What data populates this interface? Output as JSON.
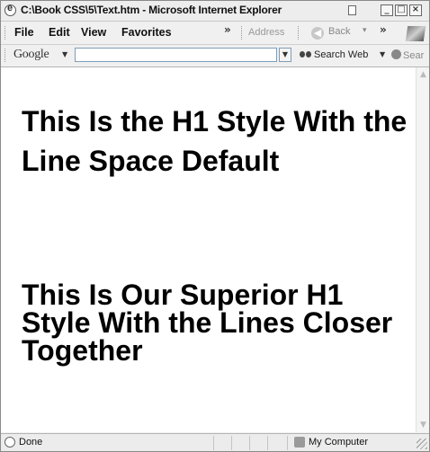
{
  "window": {
    "title": "C:\\Book CSS\\5\\Text.htm - Microsoft Internet Explorer"
  },
  "menubar": {
    "items": [
      "File",
      "Edit",
      "View",
      "Favorites"
    ],
    "chevron": "»",
    "address_label": "Address",
    "back_label": "Back"
  },
  "google_toolbar": {
    "logo": "Google",
    "search_value": "",
    "search_web_label": "Search Web",
    "site_search_label": "Sear"
  },
  "content": {
    "heading_default": "This Is the H1 Style With the Line Space Default",
    "heading_superior": "This Is Our Superior H1 Style With the Lines Closer Together"
  },
  "statusbar": {
    "status": "Done",
    "zone": "My Computer"
  },
  "icons": {
    "app": "ie-icon",
    "back": "back-arrow-icon",
    "windows": "windows-logo-icon",
    "search_web": "binoculars-icon",
    "site_search": "globe-icon",
    "status": "ie-page-icon",
    "zone": "computer-icon"
  }
}
